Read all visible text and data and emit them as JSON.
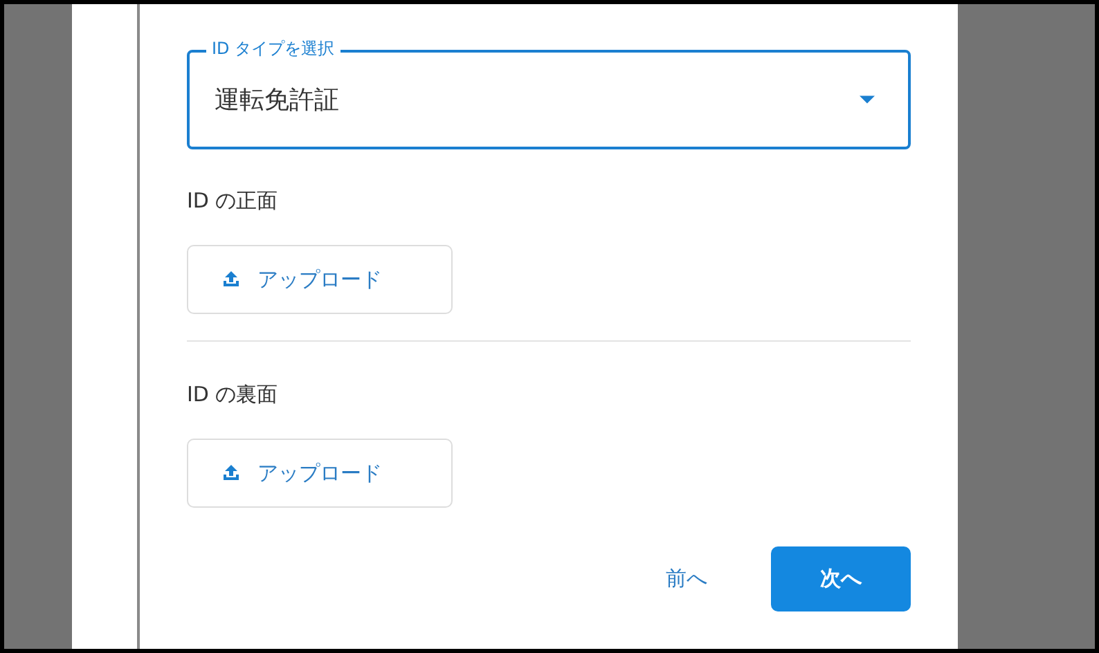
{
  "id_type_select": {
    "label": "ID タイプを選択",
    "value": "運転免許証"
  },
  "sections": [
    {
      "label": "ID の正面",
      "button": "アップロード"
    },
    {
      "label": "ID の裏面",
      "button": "アップロード"
    }
  ],
  "buttons": [
    {
      "label": "前へ",
      "kind": "text"
    },
    {
      "label": "次へ",
      "kind": "primary"
    }
  ]
}
